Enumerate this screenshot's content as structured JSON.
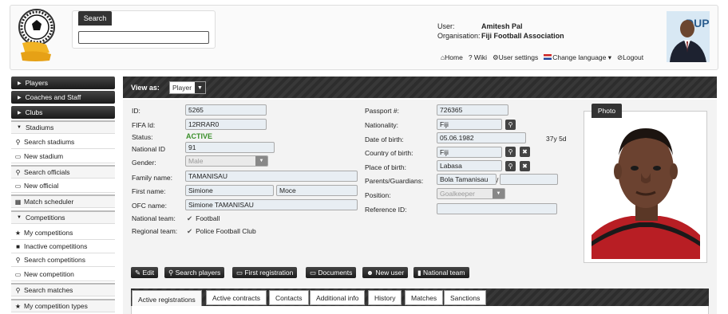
{
  "header": {
    "search_title": "Search",
    "search_value": "",
    "user_label": "User:",
    "user_name": "Amitesh Pal",
    "org_label": "Organisation:",
    "org_name": "Fiji Football Association",
    "nav": [
      {
        "icon": "home-icon",
        "label": "Home"
      },
      {
        "icon": "help-icon",
        "label": "Wiki"
      },
      {
        "icon": "gear-icon",
        "label": "User settings"
      },
      {
        "icon": "flag-icon",
        "label": "Change language"
      },
      {
        "icon": "logout-icon",
        "label": "Logout"
      }
    ]
  },
  "sidebar": {
    "items": [
      {
        "label": "Players"
      },
      {
        "label": "Coaches and Staff"
      },
      {
        "label": "Clubs"
      },
      {
        "label": "Stadiums"
      },
      {
        "label": "Search stadiums"
      },
      {
        "label": "New stadium"
      },
      {
        "label": "Search officials"
      },
      {
        "label": "New official"
      },
      {
        "label": "Match scheduler"
      },
      {
        "label": "Competitions"
      },
      {
        "label": "My competitions"
      },
      {
        "label": "Inactive competitions"
      },
      {
        "label": "Search competitions"
      },
      {
        "label": "New competition"
      },
      {
        "label": "Search matches"
      },
      {
        "label": "My competition types"
      }
    ]
  },
  "view": {
    "label": "View as:",
    "value": "Player"
  },
  "form": {
    "id_label": "ID:",
    "id_value": "5265",
    "fifa_label": "FIFA Id:",
    "fifa_value": "12RRAR0",
    "status_label": "Status:",
    "status_value": "ACTIVE",
    "national_id_label": "National ID",
    "national_id_value": "91",
    "gender_label": "Gender:",
    "gender_value": "Male",
    "family_label": "Family name:",
    "family_value": "TAMANISAU",
    "first_label": "First name:",
    "first_value": "Simione",
    "middle_value": "Moce",
    "ofc_label": "OFC name:",
    "ofc_value": "Simione TAMANISAU",
    "national_team_label": "National team:",
    "national_team_value": "Football",
    "regional_team_label": "Regional team:",
    "regional_team_value": "Police Football Club",
    "passport_label": "Passport #:",
    "passport_value": "726365",
    "nationality_label": "Nationality:",
    "nationality_value": "Fiji",
    "dob_label": "Date of birth:",
    "dob_value": "05.06.1982",
    "age_value": "37y 5d",
    "cob_label": "Country of birth:",
    "cob_value": "Fiji",
    "pob_label": "Place of birth:",
    "pob_value": "Labasa",
    "parents_label": "Parents/Guardians:",
    "parents_value": "Bola Tamanisau",
    "parents_sep": "/",
    "parents_value2": "",
    "position_label": "Position:",
    "position_value": "Goalkeeper",
    "reference_label": "Reference ID:",
    "reference_value": ""
  },
  "photo": {
    "title": "Photo"
  },
  "actions": [
    {
      "icon": "pencil-icon",
      "label": "Edit"
    },
    {
      "icon": "search-icon",
      "label": "Search players"
    },
    {
      "icon": "document-icon",
      "label": "First registration"
    },
    {
      "icon": "document-icon",
      "label": "Documents"
    },
    {
      "icon": "user-icon",
      "label": "New user"
    },
    {
      "icon": "trash-icon",
      "label": "National team"
    }
  ],
  "tabs": [
    {
      "label": "Active registrations"
    },
    {
      "label": "Active contracts"
    },
    {
      "label": "Contacts"
    },
    {
      "label": "Additional info"
    },
    {
      "label": "History"
    },
    {
      "label": "Matches"
    },
    {
      "label": "Sanctions"
    }
  ],
  "colors": {
    "status_active": "#3a8f2a",
    "dark_bar": "#2d2d2d",
    "field_bg": "#e8eef3"
  }
}
